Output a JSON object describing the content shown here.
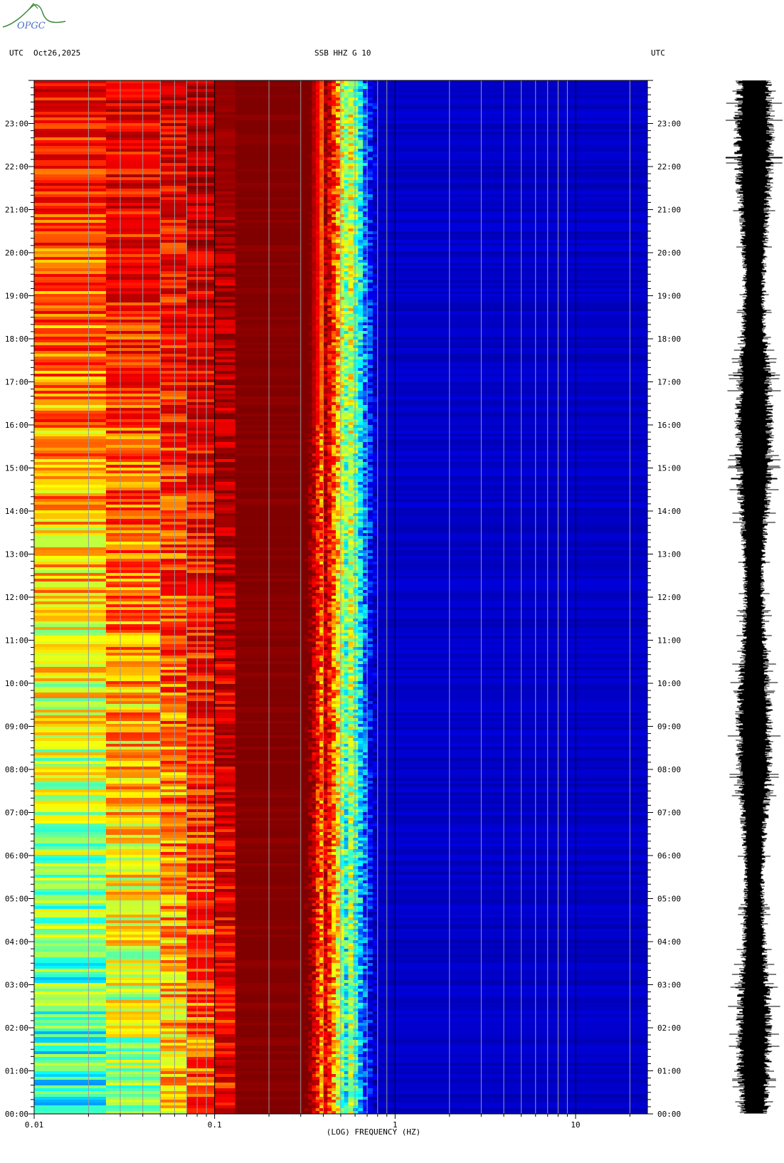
{
  "header": {
    "left_tz": "UTC",
    "date": "Oct26,2025",
    "station": "SSB HHZ G 10",
    "right_tz": "UTC"
  },
  "logo": {
    "text": "OPGC",
    "color": "#3a8a3a",
    "text_color": "#4a6fc8"
  },
  "chart_data": {
    "type": "heatmap",
    "title": "SSB HHZ G 10",
    "xlabel": "(LOG) FREQUENCY (HZ)",
    "ylabel": "UTC",
    "x_scale": "log",
    "xlim": [
      0.01,
      25
    ],
    "x_ticks": [
      {
        "value": 0.01,
        "label": "0.01"
      },
      {
        "value": 0.1,
        "label": "0.1"
      },
      {
        "value": 1,
        "label": "1"
      },
      {
        "value": 10,
        "label": "10"
      }
    ],
    "ylim_hours": [
      0,
      24
    ],
    "y_ticks": [
      {
        "value": 0,
        "label": "00:00"
      },
      {
        "value": 1,
        "label": "01:00"
      },
      {
        "value": 2,
        "label": "02:00"
      },
      {
        "value": 3,
        "label": "03:00"
      },
      {
        "value": 4,
        "label": "04:00"
      },
      {
        "value": 5,
        "label": "05:00"
      },
      {
        "value": 6,
        "label": "06:00"
      },
      {
        "value": 7,
        "label": "07:00"
      },
      {
        "value": 8,
        "label": "08:00"
      },
      {
        "value": 9,
        "label": "09:00"
      },
      {
        "value": 10,
        "label": "10:00"
      },
      {
        "value": 11,
        "label": "11:00"
      },
      {
        "value": 12,
        "label": "12:00"
      },
      {
        "value": 13,
        "label": "13:00"
      },
      {
        "value": 14,
        "label": "14:00"
      },
      {
        "value": 15,
        "label": "15:00"
      },
      {
        "value": 16,
        "label": "16:00"
      },
      {
        "value": 17,
        "label": "17:00"
      },
      {
        "value": 18,
        "label": "18:00"
      },
      {
        "value": 19,
        "label": "19:00"
      },
      {
        "value": 20,
        "label": "20:00"
      },
      {
        "value": 21,
        "label": "21:00"
      },
      {
        "value": 22,
        "label": "22:00"
      },
      {
        "value": 23,
        "label": "23:00"
      }
    ],
    "frequency_bands": [
      {
        "f_min": 0.01,
        "f_max": 0.025,
        "level_at_0h": 0.42,
        "level_at_24h": 0.82
      },
      {
        "f_min": 0.025,
        "f_max": 0.05,
        "level_at_0h": 0.52,
        "level_at_24h": 0.88
      },
      {
        "f_min": 0.05,
        "f_max": 0.07,
        "level_at_0h": 0.62,
        "level_at_24h": 0.88
      },
      {
        "f_min": 0.07,
        "f_max": 0.1,
        "level_at_0h": 0.72,
        "level_at_24h": 0.92
      },
      {
        "f_min": 0.1,
        "f_max": 0.13,
        "level_at_0h": 0.82,
        "level_at_24h": 0.97
      },
      {
        "f_min": 0.13,
        "f_max": 0.3,
        "level_at_0h": 1.0,
        "level_at_24h": 1.0
      },
      {
        "f_min": 0.3,
        "f_max": 0.4,
        "level_at_0h": 0.93,
        "level_at_24h": 0.96
      },
      {
        "f_min": 0.4,
        "f_max": 0.55,
        "level_at_0h": 0.62,
        "level_at_24h": 0.74
      },
      {
        "f_min": 0.55,
        "f_max": 0.8,
        "level_at_0h": 0.3,
        "level_at_24h": 0.36
      },
      {
        "f_min": 0.8,
        "f_max": 25,
        "level_at_0h": 0.1,
        "level_at_24h": 0.1
      }
    ],
    "grid_freqs": [
      0.02,
      0.03,
      0.04,
      0.05,
      0.06,
      0.07,
      0.08,
      0.09,
      0.2,
      0.3,
      0.4,
      0.5,
      0.6,
      0.7,
      0.8,
      0.9,
      2,
      3,
      4,
      5,
      6,
      7,
      8,
      9,
      20
    ],
    "colormap": [
      "#00008f",
      "#0000ff",
      "#00ffff",
      "#ffff00",
      "#ff0000",
      "#800000"
    ],
    "grid_color": "#9a9a9a",
    "trace_color": "#000000"
  }
}
